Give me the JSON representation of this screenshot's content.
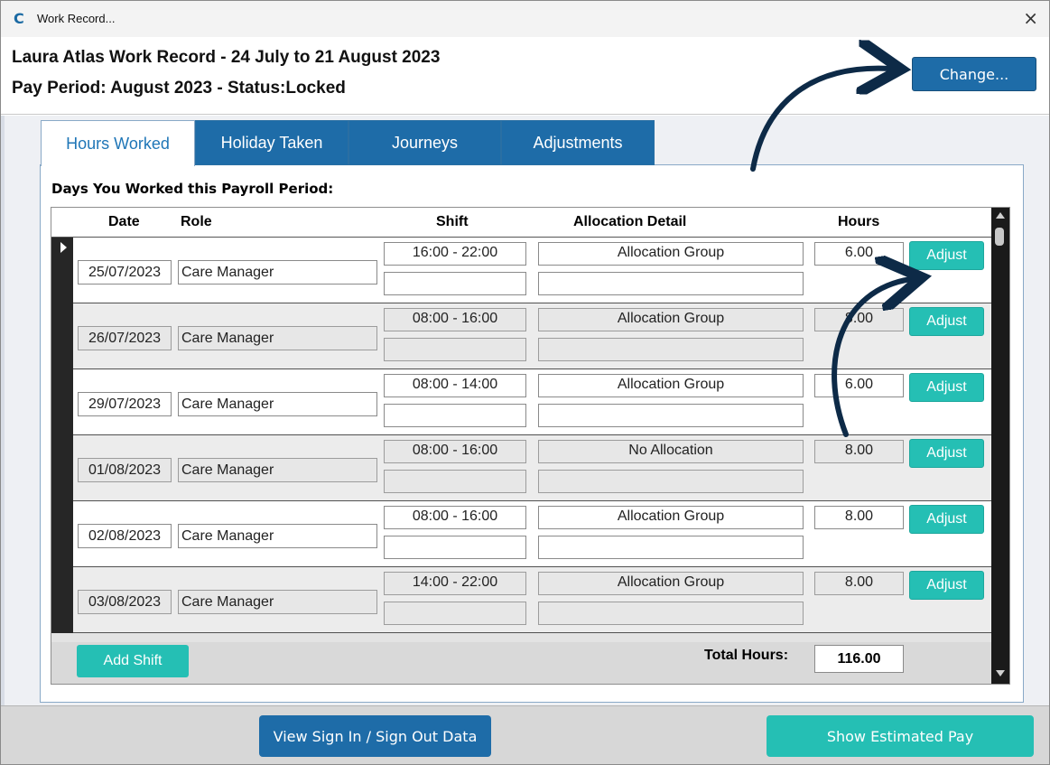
{
  "window": {
    "title": "Work Record...",
    "close_glyph": "×",
    "app_icon": "C"
  },
  "header": {
    "line1": "Laura Atlas Work Record - 24 July to 21 August 2023",
    "line2": "Pay Period: August 2023 - Status:Locked",
    "change_label": "Change..."
  },
  "tabs": [
    {
      "label": "Hours Worked",
      "active": true
    },
    {
      "label": "Holiday Taken",
      "active": false
    },
    {
      "label": "Journeys",
      "active": false
    },
    {
      "label": "Adjustments",
      "active": false
    }
  ],
  "section_title": "Days You Worked this Payroll Period:",
  "columns": {
    "date": "Date",
    "role": "Role",
    "shift": "Shift",
    "allocation": "Allocation Detail",
    "hours": "Hours"
  },
  "rows": [
    {
      "date": "25/07/2023",
      "role": "Care Manager",
      "shift": "16:00 - 22:00",
      "allocation": "Allocation Group",
      "hours": "6.00",
      "action": "Adjust"
    },
    {
      "date": "26/07/2023",
      "role": "Care Manager",
      "shift": "08:00 - 16:00",
      "allocation": "Allocation Group",
      "hours": "8.00",
      "action": "Adjust"
    },
    {
      "date": "29/07/2023",
      "role": "Care Manager",
      "shift": "08:00 - 14:00",
      "allocation": "Allocation Group",
      "hours": "6.00",
      "action": "Adjust"
    },
    {
      "date": "01/08/2023",
      "role": "Care Manager",
      "shift": "08:00 - 16:00",
      "allocation": "No Allocation",
      "hours": "8.00",
      "action": "Adjust"
    },
    {
      "date": "02/08/2023",
      "role": "Care Manager",
      "shift": "08:00 - 16:00",
      "allocation": "Allocation Group",
      "hours": "8.00",
      "action": "Adjust"
    },
    {
      "date": "03/08/2023",
      "role": "Care Manager",
      "shift": "14:00 - 22:00",
      "allocation": "Allocation Group",
      "hours": "8.00",
      "action": "Adjust"
    }
  ],
  "footer": {
    "add_shift_label": "Add Shift",
    "total_label": "Total Hours:",
    "total_value": "116.00"
  },
  "bottom": {
    "signin_label": "View Sign In / Sign Out Data",
    "estpay_label": "Show Estimated Pay"
  },
  "colors": {
    "primary_blue": "#1e6ca8",
    "teal": "#25bfb4",
    "annotation_navy": "#0d2a47"
  }
}
